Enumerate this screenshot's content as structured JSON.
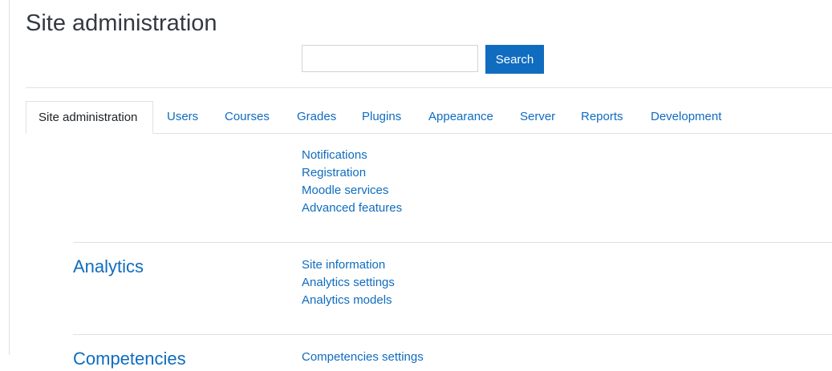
{
  "page": {
    "title": "Site administration"
  },
  "search": {
    "placeholder": "",
    "value": "",
    "button_label": "Search"
  },
  "tabs": [
    {
      "label": "Site administration",
      "active": true
    },
    {
      "label": "Users"
    },
    {
      "label": "Courses"
    },
    {
      "label": "Grades"
    },
    {
      "label": "Plugins"
    },
    {
      "label": "Appearance"
    },
    {
      "label": "Server"
    },
    {
      "label": "Reports"
    },
    {
      "label": "Development"
    }
  ],
  "general": {
    "links": [
      "Notifications",
      "Registration",
      "Moodle services",
      "Advanced features"
    ]
  },
  "analytics": {
    "title": "Analytics",
    "links": [
      "Site information",
      "Analytics settings",
      "Analytics models"
    ]
  },
  "competencies": {
    "title": "Competencies",
    "links": [
      "Competencies settings"
    ]
  },
  "colors": {
    "link": "#0f6cbf",
    "button": "#0f6cbf",
    "border": "#dee2e6"
  }
}
